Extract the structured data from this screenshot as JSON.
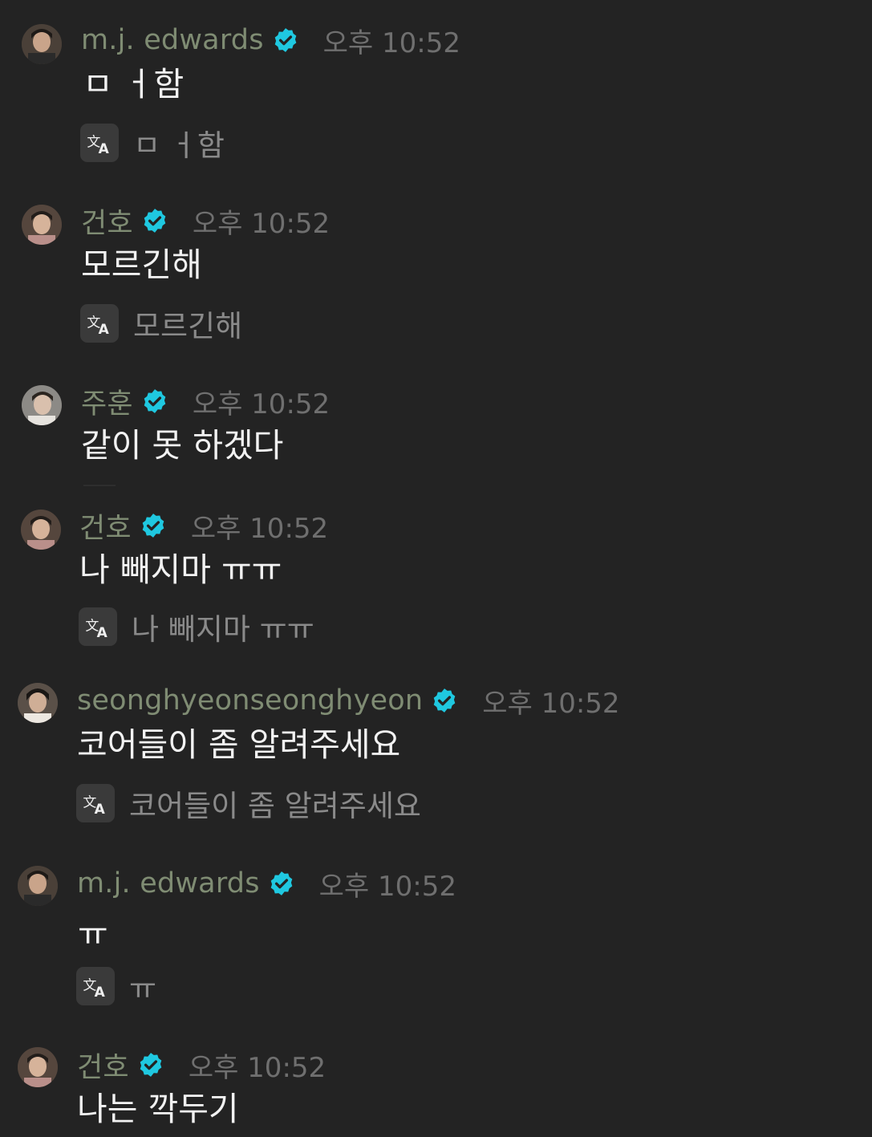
{
  "colors": {
    "background": "#232323",
    "username": "#7f8c73",
    "timestamp": "#6f6f6f",
    "message": "#f2f2f2",
    "translation": "#8a8a8a",
    "verified_badge": "#1fc8e0",
    "translate_button": "#3a3a3a"
  },
  "icons": {
    "verified": "verified-badge-icon",
    "translate": "translate-icon"
  },
  "messages": [
    {
      "username": "m.j. edwards",
      "time": "오후 10:52",
      "text": "ㅁ ㅓ함",
      "translation": "ㅁ ㅓ함",
      "has_translation": true
    },
    {
      "username": "건호",
      "time": "오후 10:52",
      "text": "모르긴해",
      "translation": "모르긴해",
      "has_translation": true
    },
    {
      "username": "주훈",
      "time": "오후 10:52",
      "text": "같이 못 하겠다",
      "translation": "",
      "has_translation": false
    },
    {
      "username": "건호",
      "time": "오후 10:52",
      "text": "나 빼지마 ㅠㅠ",
      "translation": "나 빼지마 ㅠㅠ",
      "has_translation": true
    },
    {
      "username": "seonghyeonseonghyeon",
      "time": "오후 10:52",
      "text": "코어들이 좀 알려주세요",
      "translation": "코어들이 좀 알려주세요",
      "has_translation": true
    },
    {
      "username": "m.j. edwards",
      "time": "오후 10:52",
      "text": "ㅠ",
      "translation": "ㅠ",
      "has_translation": true
    },
    {
      "username": "건호",
      "time": "오후 10:52",
      "text": "나는 깍두기",
      "translation": "",
      "has_translation": false
    }
  ]
}
